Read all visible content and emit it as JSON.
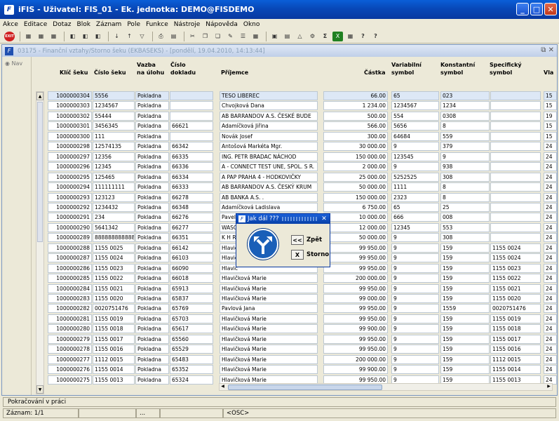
{
  "window": {
    "title": "iFIS - Uživatel: FIS_01 - Ek. jednotka: DEMO@FISDEMO",
    "app_icon": "iFIS"
  },
  "menu": [
    "Akce",
    "Editace",
    "Dotaz",
    "Blok",
    "Záznam",
    "Pole",
    "Funkce",
    "Nástroje",
    "Nápověda",
    "Okno"
  ],
  "toolbar": {
    "exit_label": "EXIT"
  },
  "form": {
    "title": "03175 - Finanční vztahy/Storno šeku (EKBASEKS) - [pondělí, 19.04.2010, 14:13:44]",
    "nav_label": "Nav"
  },
  "columns": {
    "klic": "Klíč šeku",
    "cislo": "Číslo šeku",
    "vazba_a": "Vazba",
    "vazba_b": "na úlohu",
    "doklad_a": "Číslo",
    "doklad_b": "dokladu",
    "prijemce": "Příjemce",
    "castka": "Částka",
    "var_a": "Variabilní",
    "var_b": "symbol",
    "konst_a": "Konstantní",
    "konst_b": "symbol",
    "spec_a": "Specifický",
    "spec_b": "symbol",
    "last": "Vla"
  },
  "rows": [
    {
      "klic": "1000000304",
      "cislo": "5556",
      "vazba": "Pokladna",
      "doklad": "",
      "prijemce": "TESO LIBEREC",
      "castka": "66.00",
      "vs": "65",
      "ks": "023",
      "ss": "",
      "x": "15"
    },
    {
      "klic": "1000000303",
      "cislo": "1234567",
      "vazba": "Pokladna",
      "doklad": "",
      "prijemce": "Chvojková Dana",
      "castka": "1 234.00",
      "vs": "1234567",
      "ks": "1234",
      "ss": "",
      "x": "15"
    },
    {
      "klic": "1000000302",
      "cislo": "55444",
      "vazba": "Pokladna",
      "doklad": "",
      "prijemce": "AB BARRANDOV A.S. ČESKÉ BUDE",
      "castka": "500.00",
      "vs": "554",
      "ks": "0308",
      "ss": "",
      "x": "19"
    },
    {
      "klic": "1000000301",
      "cislo": "3456345",
      "vazba": "Pokladna",
      "doklad": "66621",
      "prijemce": "Adamíčková Jiřina",
      "castka": "566.00",
      "vs": "5656",
      "ks": "8",
      "ss": "",
      "x": "15"
    },
    {
      "klic": "1000000300",
      "cislo": "111",
      "vazba": "Pokladna",
      "doklad": "",
      "prijemce": "Novák Josef",
      "castka": "300.00",
      "vs": "64684",
      "ks": "559",
      "ss": "",
      "x": "15"
    },
    {
      "klic": "1000000298",
      "cislo": "12574135",
      "vazba": "Pokladna",
      "doklad": "66342",
      "prijemce": "Antošová Markéta Mgr.",
      "castka": "30 000.00",
      "vs": "9",
      "ks": "379",
      "ss": "",
      "x": "24"
    },
    {
      "klic": "1000000297",
      "cislo": "12356",
      "vazba": "Pokladna",
      "doklad": "66335",
      "prijemce": "ING. PETR BRADAC NÁCHOD",
      "castka": "150 000.00",
      "vs": "123545",
      "ks": "9",
      "ss": "",
      "x": "24"
    },
    {
      "klic": "1000000296",
      "cislo": "12345",
      "vazba": "Pokladna",
      "doklad": "66336",
      "prijemce": "A - CONNECT TEST UNE, SPOL. S R.",
      "castka": "2 000.00",
      "vs": "9",
      "ks": "938",
      "ss": "",
      "x": "24"
    },
    {
      "klic": "1000000295",
      "cislo": "125465",
      "vazba": "Pokladna",
      "doklad": "66334",
      "prijemce": "A PAP PRAHA 4 - HODKOVIČKY",
      "castka": "25 000.00",
      "vs": "5252525",
      "ks": "308",
      "ss": "",
      "x": "24"
    },
    {
      "klic": "1000000294",
      "cislo": "111111111",
      "vazba": "Pokladna",
      "doklad": "66333",
      "prijemce": "AB BARRANDOV A.S. ČESKÝ KRUM",
      "castka": "50 000.00",
      "vs": "1111",
      "ks": "8",
      "ss": "",
      "x": "24"
    },
    {
      "klic": "1000000293",
      "cislo": "123123",
      "vazba": "Pokladna",
      "doklad": "66278",
      "prijemce": "AB BANKA A.S. .",
      "castka": "150 000.00",
      "vs": "2323",
      "ks": "8",
      "ss": "",
      "x": "24"
    },
    {
      "klic": "1000000292",
      "cislo": "1234432",
      "vazba": "Pokladna",
      "doklad": "66348",
      "prijemce": "Adamíčková Ladislava",
      "castka": "6 750.00",
      "vs": "65",
      "ks": "25",
      "ss": "",
      "x": "24"
    },
    {
      "klic": "1000000291",
      "cislo": "234",
      "vazba": "Pokladna",
      "doklad": "66276",
      "prijemce": "Pavel",
      "castka": "10 000.00",
      "vs": "666",
      "ks": "008",
      "ss": "",
      "x": "24"
    },
    {
      "klic": "1000000290",
      "cislo": "5641342",
      "vazba": "Pokladna",
      "doklad": "66277",
      "prijemce": "WASC",
      "castka": "12 000.00",
      "vs": "12345",
      "ks": "553",
      "ss": "",
      "x": "24"
    },
    {
      "klic": "1000000289",
      "cislo": "888888888888",
      "vazba": "Pokladna",
      "doklad": "66351",
      "prijemce": "K H R",
      "castka": "50 000.00",
      "vs": "9",
      "ks": "308",
      "ss": "",
      "x": "24"
    },
    {
      "klic": "1000000288",
      "cislo": "1155 0025",
      "vazba": "Pokladna",
      "doklad": "66142",
      "prijemce": "Hlavič",
      "castka": "99 950.00",
      "vs": "9",
      "ks": "159",
      "ss": "1155 0024",
      "x": "24"
    },
    {
      "klic": "1000000287",
      "cislo": "1155 0024",
      "vazba": "Pokladna",
      "doklad": "66103",
      "prijemce": "Hlavič",
      "castka": "99 950.00",
      "vs": "9",
      "ks": "159",
      "ss": "1155  0024",
      "x": "24"
    },
    {
      "klic": "1000000286",
      "cislo": "1155 0023",
      "vazba": "Pokladna",
      "doklad": "66090",
      "prijemce": "Hlavič",
      "castka": "99 950.00",
      "vs": "9",
      "ks": "159",
      "ss": "1155 0023",
      "x": "24"
    },
    {
      "klic": "1000000285",
      "cislo": "1155 0022",
      "vazba": "Pokladna",
      "doklad": "66018",
      "prijemce": "Hlavičková Marie",
      "castka": "200 000.00",
      "vs": "9",
      "ks": "159",
      "ss": "1155 0022",
      "x": "24"
    },
    {
      "klic": "1000000284",
      "cislo": "1155  0021",
      "vazba": "Pokladna",
      "doklad": "65913",
      "prijemce": "Hlavičková Marie",
      "castka": "99 950.00",
      "vs": "9",
      "ks": "159",
      "ss": "1155 0021",
      "x": "24"
    },
    {
      "klic": "1000000283",
      "cislo": "1155 0020",
      "vazba": "Pokladna",
      "doklad": "65837",
      "prijemce": "Hlavičková Marie",
      "castka": "99 000.00",
      "vs": "9",
      "ks": "159",
      "ss": "1155 0020",
      "x": "24"
    },
    {
      "klic": "1000000282",
      "cislo": "0020751476",
      "vazba": "Pokladna",
      "doklad": "65769",
      "prijemce": "Pavlová Jana",
      "castka": "99 950.00",
      "vs": "9",
      "ks": "1559",
      "ss": "0020751476",
      "x": "24"
    },
    {
      "klic": "1000000281",
      "cislo": "1155 0019",
      "vazba": "Pokladna",
      "doklad": "65703",
      "prijemce": "Hlavičková Marie",
      "castka": "99 950.00",
      "vs": "9",
      "ks": "159",
      "ss": "1155 0019",
      "x": "24"
    },
    {
      "klic": "1000000280",
      "cislo": "1155 0018",
      "vazba": "Pokladna",
      "doklad": "65617",
      "prijemce": "Hlavičková Marie",
      "castka": "99 900.00",
      "vs": "9",
      "ks": "159",
      "ss": "1155 0018",
      "x": "24"
    },
    {
      "klic": "1000000279",
      "cislo": "1155 0017",
      "vazba": "Pokladna",
      "doklad": "65560",
      "prijemce": "Hlavičková Marie",
      "castka": "99 950.00",
      "vs": "9",
      "ks": "159",
      "ss": "1155 0017",
      "x": "24"
    },
    {
      "klic": "1000000278",
      "cislo": "1155 0016",
      "vazba": "Pokladna",
      "doklad": "65529",
      "prijemce": "Hlavičková Marie",
      "castka": "99 950.00",
      "vs": "9",
      "ks": "159",
      "ss": "1155 0016",
      "x": "24"
    },
    {
      "klic": "1000000277",
      "cislo": "1112 0015",
      "vazba": "Pokladna",
      "doklad": "65483",
      "prijemce": "Hlavičková Marie",
      "castka": "200 000.00",
      "vs": "9",
      "ks": "159",
      "ss": "1112 0015",
      "x": "24"
    },
    {
      "klic": "1000000276",
      "cislo": "1155 0014",
      "vazba": "Pokladna",
      "doklad": "65352",
      "prijemce": "Hlavičková Marie",
      "castka": "99 900.00",
      "vs": "9",
      "ks": "159",
      "ss": "1155 0014",
      "x": "24"
    },
    {
      "klic": "1000000275",
      "cislo": "1155 0013",
      "vazba": "Pokladna",
      "doklad": "65324",
      "prijemce": "Hlavičková Marie",
      "castka": "99 950.00",
      "vs": "9",
      "ks": "159",
      "ss": "1155  0013",
      "x": "24"
    }
  ],
  "dialog": {
    "title": "Jak dál ???",
    "back_label": "Zpět",
    "back_btn": "<<",
    "cancel_label": "Storno",
    "cancel_btn": "X"
  },
  "status": {
    "message": "Pokračování v práci",
    "record": "Záznam: 1/1",
    "indicator": "...",
    "osc": "<OSC>"
  }
}
